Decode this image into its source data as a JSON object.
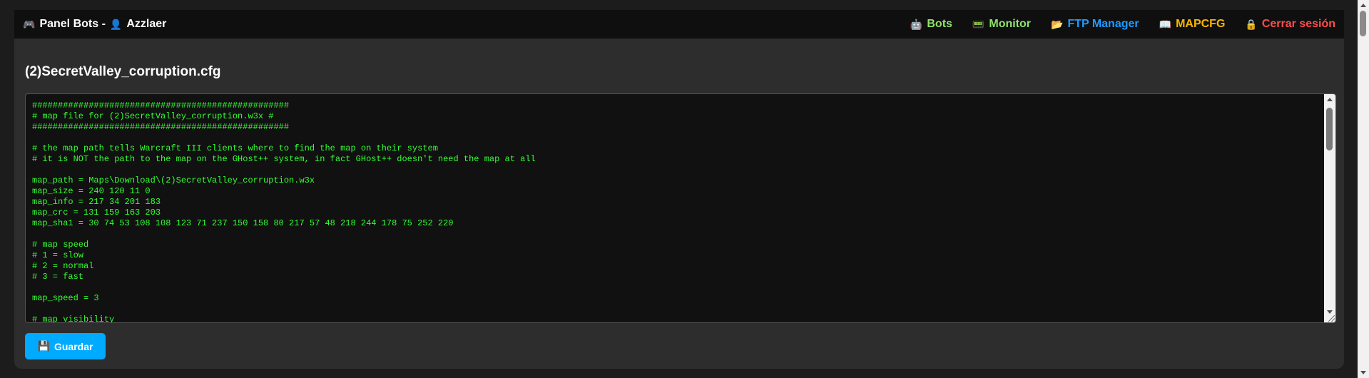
{
  "navbar": {
    "brand_icon": "🎮",
    "brand_text": "Panel Bots -",
    "user_icon": "👤",
    "user_name": "Azzlaer",
    "links": [
      {
        "icon": "🤖",
        "label": "Bots",
        "color": "#8fe36b"
      },
      {
        "icon": "📟",
        "label": "Monitor",
        "color": "#8fe36b"
      },
      {
        "icon": "📂",
        "label": "FTP Manager",
        "color": "#1e9bff"
      },
      {
        "icon": "📖",
        "label": "MAPCFG",
        "color": "#f5b800"
      },
      {
        "icon": "🔒",
        "label": "Cerrar sesión",
        "color": "#ff4d4d"
      }
    ]
  },
  "editor": {
    "filename": "(2)SecretValley_corruption.cfg",
    "content": "##################################################\n# map file for (2)SecretValley_corruption.w3x #\n##################################################\n\n# the map path tells Warcraft III clients where to find the map on their system\n# it is NOT the path to the map on the GHost++ system, in fact GHost++ doesn't need the map at all\n\nmap_path = Maps\\Download\\(2)SecretValley_corruption.w3x\nmap_size = 240 120 11 0\nmap_info = 217 34 201 183\nmap_crc = 131 159 163 203\nmap_sha1 = 30 74 53 108 108 123 71 237 150 158 80 217 57 48 218 244 178 75 252 220\n\n# map speed\n# 1 = slow\n# 2 = normal\n# 3 = fast\n\nmap_speed = 3\n\n# map visibility"
  },
  "actions": {
    "save_icon": "💾",
    "save_label": "Guardar"
  },
  "colors": {
    "accent": "#00aaff",
    "editor_text": "#33ff33",
    "background": "#2d2d2d"
  }
}
